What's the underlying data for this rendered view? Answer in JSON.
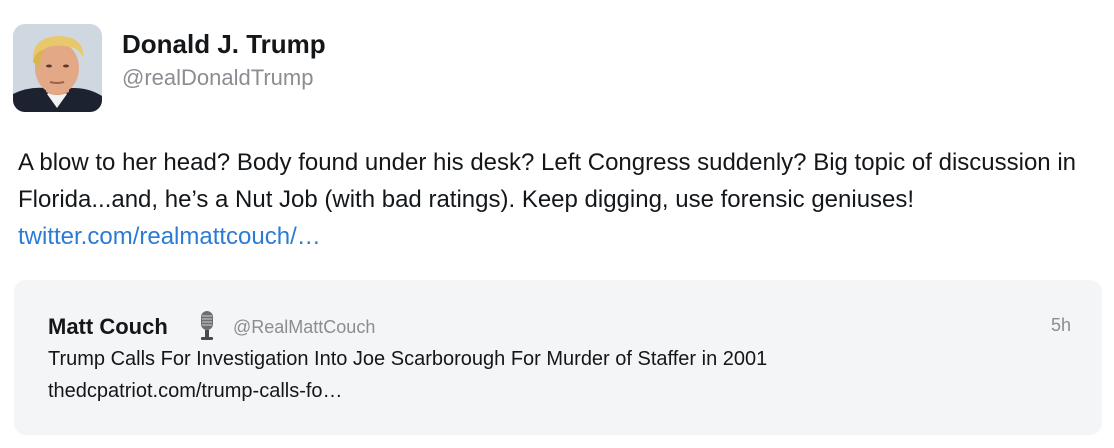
{
  "author": {
    "display_name": "Donald J. Trump",
    "handle": "@realDonaldTrump"
  },
  "tweet": {
    "text": "A blow to her head? Body found under his desk? Left Congress suddenly? Big topic of discussion in Florida...and, he’s a Nut Job (with bad ratings). Keep digging, use forensic geniuses! ",
    "link_text": "twitter.com/realmattcouch/…"
  },
  "quoted_tweet": {
    "display_name": "Matt Couch",
    "name_icon": "microphone-icon",
    "handle": "@RealMattCouch",
    "time": "5h",
    "text": "Trump Calls For Investigation Into Joe Scarborough For Murder of Staffer in 2001",
    "link_text": "thedcpatriot.com/trump-calls-fo…"
  },
  "colors": {
    "link": "#2b7bd6",
    "secondary_text": "#8a8d91",
    "quote_background": "#f4f5f6"
  }
}
